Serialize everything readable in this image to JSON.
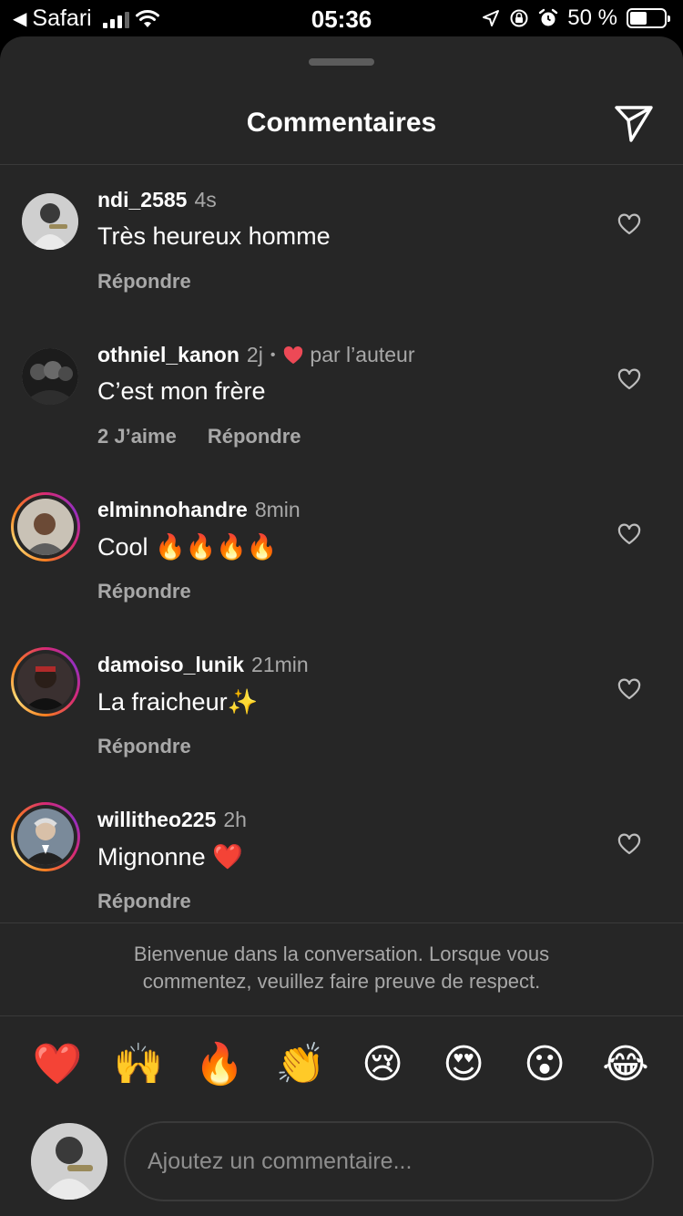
{
  "status_bar": {
    "back_app": "Safari",
    "time": "05:36",
    "battery_text": "50 %",
    "battery_level": 0.5
  },
  "sheet": {
    "title": "Commentaires"
  },
  "comments": [
    {
      "username": "ndi_2585",
      "time": "4s",
      "text": "Très heureux homme",
      "likes": "",
      "reply_label": "Répondre",
      "by_author": "",
      "story_ring": false
    },
    {
      "username": "othniel_kanon",
      "time": "2j",
      "text": "C’est mon frère",
      "likes": "2 J’aime",
      "reply_label": "Répondre",
      "by_author": "par l’auteur",
      "story_ring": false
    },
    {
      "username": "elminnohandre",
      "time": "8min",
      "text": "Cool 🔥🔥🔥🔥",
      "likes": "",
      "reply_label": "Répondre",
      "by_author": "",
      "story_ring": true
    },
    {
      "username": "damoiso_lunik",
      "time": "21min",
      "text": "La fraicheur✨",
      "likes": "",
      "reply_label": "Répondre",
      "by_author": "",
      "story_ring": true
    },
    {
      "username": "willitheo225",
      "time": "2h",
      "text": "Mignonne ❤️",
      "likes": "",
      "reply_label": "Répondre",
      "by_author": "",
      "story_ring": true
    }
  ],
  "welcome_text_line1": "Bienvenue dans la conversation. Lorsque vous",
  "welcome_text_line2": "commentez, veuillez faire preuve de respect.",
  "quick_emojis": [
    "❤️",
    "🙌",
    "🔥",
    "👏",
    "😢",
    "😍",
    "😮",
    "😂"
  ],
  "composer": {
    "placeholder": "Ajoutez un commentaire..."
  },
  "colors": {
    "sheet_bg": "#262626",
    "secondary_text": "#a8a8a8",
    "heart_red": "#ed4956"
  }
}
